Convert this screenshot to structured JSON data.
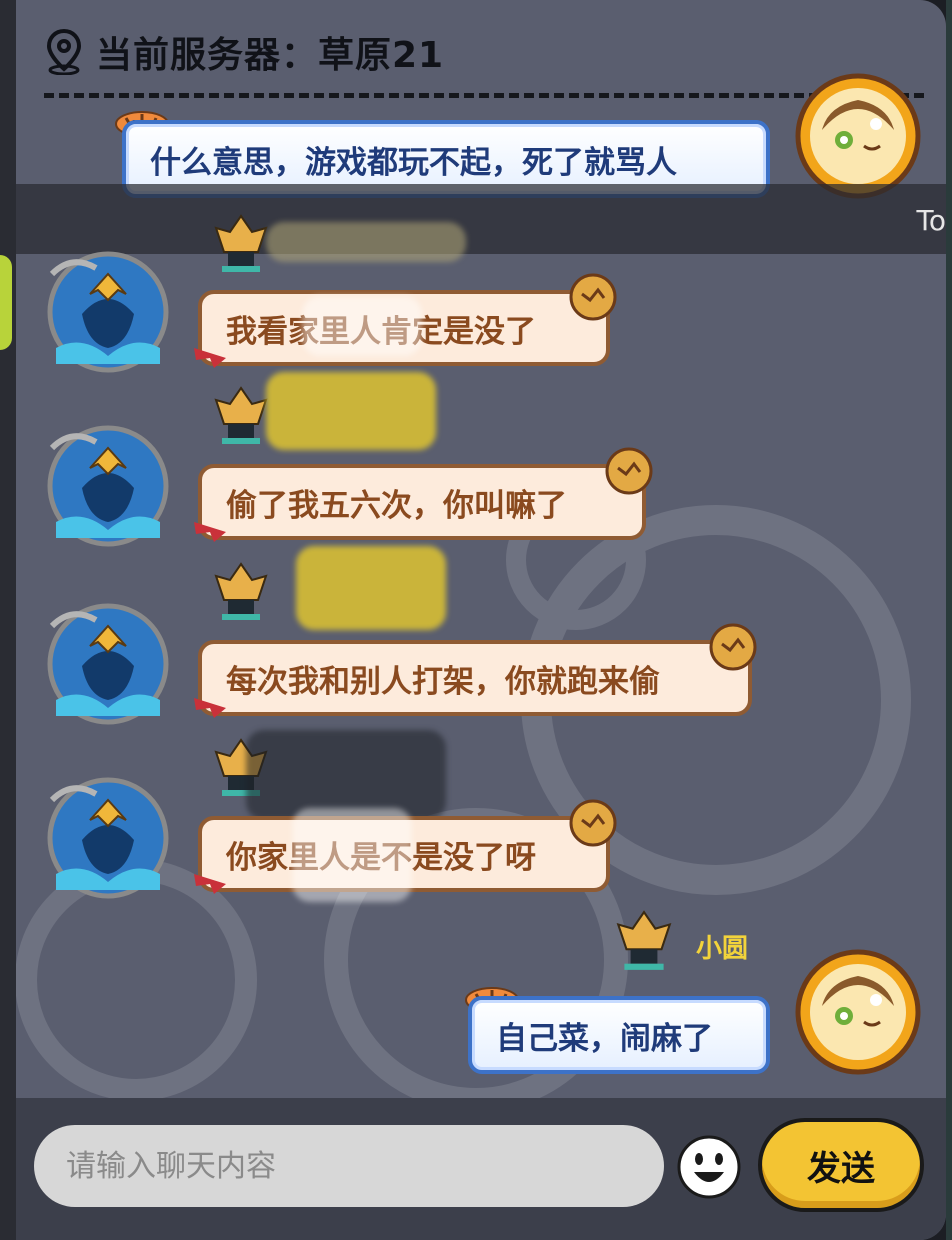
{
  "header": {
    "server_label": "当前服务器：草原21",
    "location_icon": "map-pin-icon"
  },
  "notice": {
    "text": "To"
  },
  "messages": [
    {
      "side": "right",
      "text": "什么意思，游戏都玩不起，死了就骂人"
    },
    {
      "side": "left",
      "text": "我看家里人肯定是没了"
    },
    {
      "side": "left",
      "text": "偷了我五六次，你叫嘛了"
    },
    {
      "side": "left",
      "text": "每次我和别人打架，你就跑来偷"
    },
    {
      "side": "left",
      "text": "你家里人是不是没了呀"
    },
    {
      "side": "right",
      "name": "小圆",
      "text": "自己菜，闹麻了"
    }
  ],
  "footer": {
    "input_placeholder": "请输入聊天内容",
    "emoji_icon": "smiley-face-icon",
    "send_label": "发送"
  },
  "colors": {
    "panel_bg": "#5a5e6f",
    "left_bubble_bg": "#fdebdc",
    "left_bubble_text": "#8a4a1f",
    "right_bubble_border": "#3d72c8",
    "right_bubble_text": "#1f3b7a",
    "name_color": "#f2d33b",
    "send_button": "#f3c433",
    "footer_bg": "#3c3f4b"
  }
}
